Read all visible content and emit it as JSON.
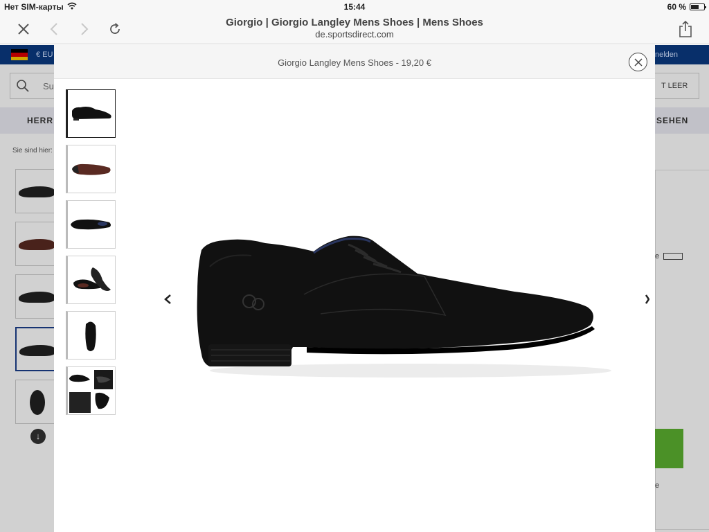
{
  "status_bar": {
    "carrier": "Нет SIM-карты",
    "time": "15:44",
    "battery": "60 %",
    "battery_level": 0.6
  },
  "browser": {
    "title": "Giorgio | Giorgio Langley Mens Shoes | Mens Shoes",
    "url": "de.sportsdirect.com"
  },
  "background": {
    "currency": "€ EU",
    "login": "nelden",
    "search_placeholder": "Su",
    "basket": "T LEER",
    "nav_left": "HERR",
    "nav_right": "SEHEN",
    "breadcrumb": "Sie sind hier:",
    "ruler_text": "e",
    "footer_text": "e"
  },
  "modal": {
    "title": "Giorgio Langley Mens Shoes - 19,20 €",
    "thumbnails": [
      {
        "label": "side",
        "selected": true
      },
      {
        "label": "sole",
        "selected": false
      },
      {
        "label": "top",
        "selected": false
      },
      {
        "label": "pair",
        "selected": false
      },
      {
        "label": "front",
        "selected": false
      },
      {
        "label": "collage",
        "selected": false
      }
    ]
  },
  "colors": {
    "header_blue": "#0a3a82",
    "green_cta": "#5cb130",
    "nav_bg": "#ececf4"
  },
  "icons": {
    "close": "close-icon",
    "back": "chevron-left-icon",
    "forward": "chevron-right-icon",
    "reload": "reload-icon",
    "share": "share-icon",
    "wifi": "wifi-icon",
    "search": "search-icon",
    "modal_close": "close-circle-icon",
    "prev": "arrow-left-icon",
    "next": "arrow-right-icon",
    "scroll_down": "arrow-down-icon"
  }
}
